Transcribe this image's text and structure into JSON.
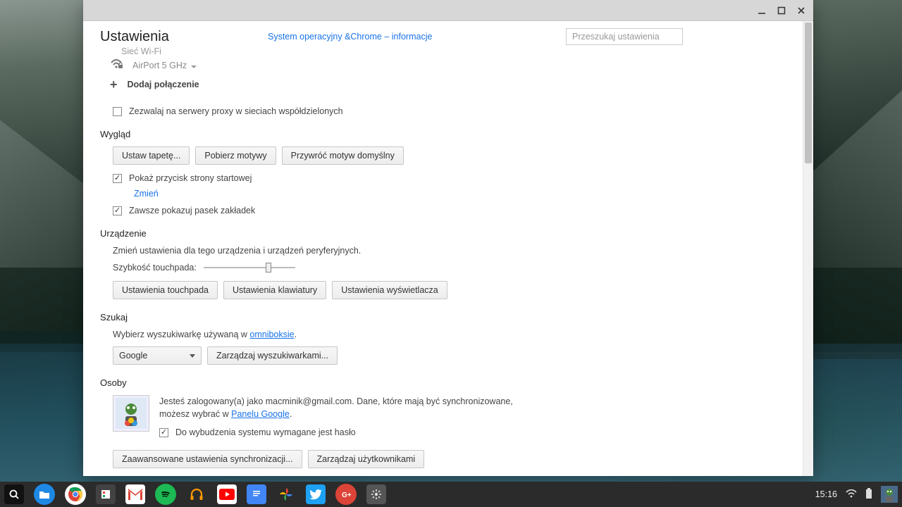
{
  "window": {
    "title": "Ustawienia",
    "chrome_info_link": "System operacyjny &Chrome – informacje",
    "search_placeholder": "Przeszukaj ustawienia"
  },
  "network": {
    "wifi_label": "Sieć Wi-Fi",
    "current_network": "AirPort 5 GHz",
    "add_connection": "Dodaj połączenie",
    "proxy_checkbox": "Zezwalaj na serwery proxy w sieciach współdzielonych",
    "proxy_checked": false
  },
  "appearance": {
    "heading": "Wygląd",
    "btn_wallpaper": "Ustaw tapetę...",
    "btn_themes": "Pobierz motywy",
    "btn_reset_theme": "Przywróć motyw domyślny",
    "show_home_button_label": "Pokaż przycisk strony startowej",
    "show_home_button_checked": true,
    "change_link": "Zmień",
    "always_show_bookmarks_label": "Zawsze pokazuj pasek zakładek",
    "always_show_bookmarks_checked": true
  },
  "device": {
    "heading": "Urządzenie",
    "description": "Zmień ustawienia dla tego urządzenia i urządzeń peryferyjnych.",
    "touchpad_speed_label": "Szybkość touchpada:",
    "btn_touchpad": "Ustawienia touchpada",
    "btn_keyboard": "Ustawienia klawiatury",
    "btn_display": "Ustawienia wyświetlacza"
  },
  "search": {
    "heading": "Szukaj",
    "description_prefix": "Wybierz wyszukiwarkę używaną w ",
    "omnibox_link": "omniboksie",
    "description_suffix": ".",
    "selected_engine": "Google",
    "btn_manage": "Zarządzaj wyszukiwarkami..."
  },
  "people": {
    "heading": "Osoby",
    "login_text_1": "Jesteś zalogowany(a) jako macminik@gmail.com. Dane, które mają być synchronizowane, możesz wybrać w ",
    "panel_link": "Panelu Google",
    "login_text_2": ".",
    "wake_password_label": "Do wybudzenia systemu wymagane jest hasło",
    "wake_password_checked": true,
    "btn_sync": "Zaawansowane ustawienia synchronizacji...",
    "btn_manage_users": "Zarządzaj użytkownikami"
  },
  "shelf": {
    "time": "15:16"
  }
}
